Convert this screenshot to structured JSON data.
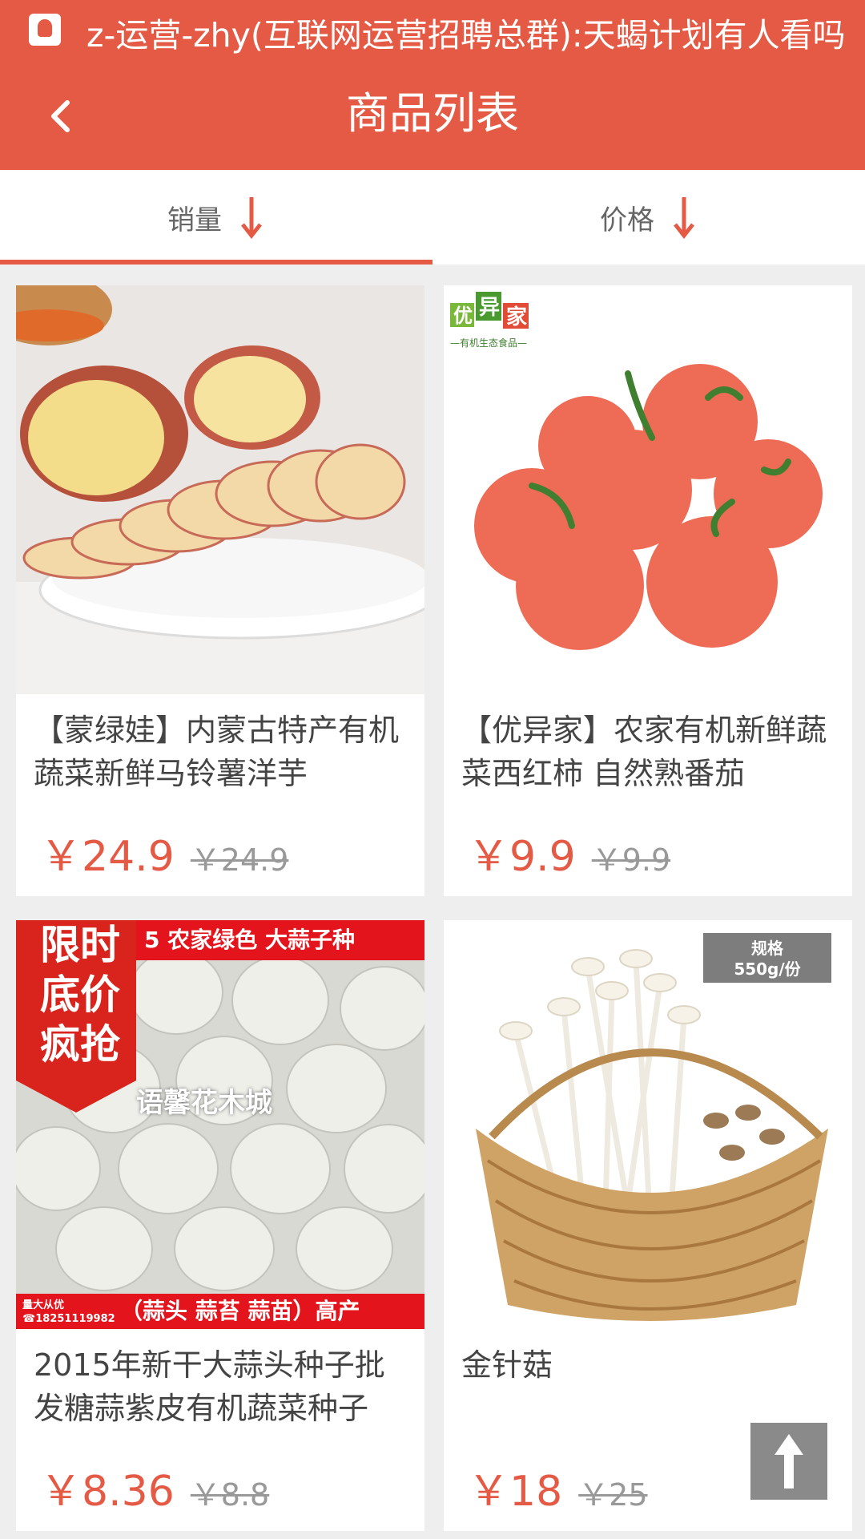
{
  "status_bar": {
    "notification": "z-运营-zhy(互联网运营招聘总群):天蝎计划有人看吗",
    "icon": "qq-icon"
  },
  "header": {
    "title": "商品列表",
    "back_icon": "chevron-left-icon"
  },
  "sort_tabs": [
    {
      "label": "销量",
      "icon": "arrow-down-icon",
      "active": true
    },
    {
      "label": "价格",
      "icon": "arrow-down-icon",
      "active": false
    }
  ],
  "products": [
    {
      "title": "【蒙绿娃】内蒙古特产有机蔬菜新鲜马铃薯洋芋",
      "price": "￥24.9",
      "old_price": "￥24.9"
    },
    {
      "title": "【优异家】农家有机新鲜蔬菜西红柿 自然熟番茄",
      "price": "￥9.9",
      "old_price": "￥9.9",
      "logo_text": "优异家",
      "logo_sub": "—有机生态食品—"
    },
    {
      "title": "2015年新干大蒜头种子批发糖蒜紫皮有机蔬菜种子",
      "price": "￥8.36",
      "old_price": "￥8.8",
      "promo": "限时底价疯抢",
      "banner_top": "5 农家绿色 大蒜子种",
      "banner_bottom": "（蒜头 蒜苔 蒜苗）高产",
      "watermark": "语馨花木城",
      "seller_note": "量大从优 ☎18251119982"
    },
    {
      "title": "金针菇",
      "price": "￥18",
      "old_price": "￥25",
      "spec_label": "规格",
      "spec_value": "550g/份"
    }
  ],
  "back_to_top_icon": "arrow-up-icon",
  "colors": {
    "accent": "#e45a45",
    "promo_red": "#e4141d"
  }
}
